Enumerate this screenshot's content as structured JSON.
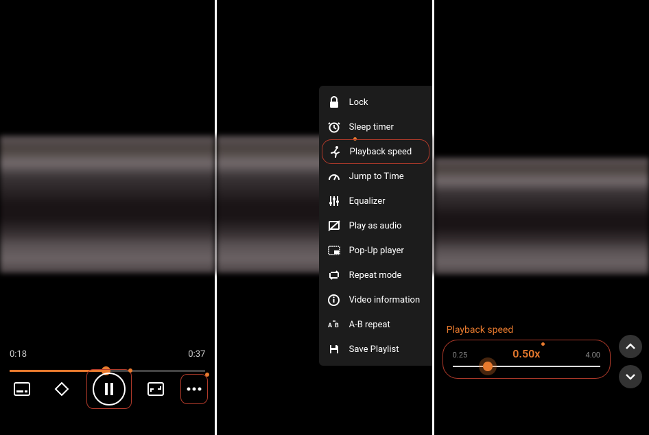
{
  "colors": {
    "accent": "#e87a2e",
    "highlight_border": "#b03a2a"
  },
  "panel1": {
    "current_time": "0:18",
    "duration": "0:37",
    "progress_percent": 49
  },
  "panel2": {
    "menu": [
      {
        "id": "lock",
        "label": "Lock"
      },
      {
        "id": "sleep-timer",
        "label": "Sleep timer"
      },
      {
        "id": "playback-speed",
        "label": "Playback speed",
        "highlighted": true
      },
      {
        "id": "jump-to-time",
        "label": "Jump to Time"
      },
      {
        "id": "equalizer",
        "label": "Equalizer"
      },
      {
        "id": "play-as-audio",
        "label": "Play as audio"
      },
      {
        "id": "popup-player",
        "label": "Pop-Up player"
      },
      {
        "id": "repeat-mode",
        "label": "Repeat mode"
      },
      {
        "id": "video-info",
        "label": "Video information"
      },
      {
        "id": "ab-repeat",
        "label": "A-B repeat"
      },
      {
        "id": "save-playlist",
        "label": "Save Playlist"
      }
    ]
  },
  "panel3": {
    "title": "Playback speed",
    "min": "0.25",
    "max": "4.00",
    "value_label": "0.50x",
    "thumb_percent": 24
  }
}
